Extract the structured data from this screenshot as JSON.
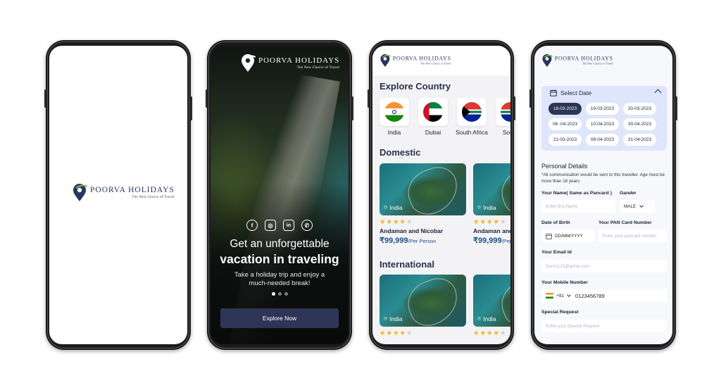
{
  "brand": {
    "name": "Poorva Holidays",
    "tagline": "The New Choice of Travel"
  },
  "splash": {},
  "onboarding": {
    "social_icons": [
      "facebook-icon",
      "instagram-icon",
      "linkedin-icon",
      "whatsapp-icon"
    ],
    "headline_1": "Get an unforgettable",
    "headline_2": "vacation in traveling",
    "subtext": "Take a holiday trip and enjoy a much-needed break!",
    "page_indicator": {
      "count": 3,
      "active": 1
    },
    "cta_label": "Explore Now"
  },
  "explore": {
    "section_country": "Explore Country",
    "countries": [
      {
        "label": "India"
      },
      {
        "label": "Dubai"
      },
      {
        "label": "South Africa"
      },
      {
        "label": "South"
      }
    ],
    "section_domestic": "Domestic",
    "domestic_cards": [
      {
        "location": "India",
        "rating": 4,
        "title": "Andaman and Nicobar",
        "price": "₹99,999",
        "per": "/Per Person"
      },
      {
        "location": "India",
        "rating": 4,
        "title": "Andaman and",
        "price": "₹99,999",
        "per": "/Per"
      }
    ],
    "section_international": "International",
    "international_cards": [
      {
        "location": "India",
        "rating": 4
      },
      {
        "location": "India",
        "rating": 4
      }
    ]
  },
  "booking": {
    "select_date": "Select Date",
    "dates": [
      "18-03-2023",
      "19-03-2023",
      "20-03-2023",
      "06 -04-2023",
      "10-04-2023",
      "30-04-2023",
      "21-03-2023",
      "08-04-2023",
      "31-04-2023"
    ],
    "selected_index": 0,
    "personal_details": "Personal Details",
    "note": "*All communication would be sent to this traveller. Age must be more than 18 years",
    "name_label": "Your Name( Same as Pancard )",
    "name_placeholder": "Enter first Name",
    "gender_label": "Gander",
    "gender_value": "MALE",
    "dob_label": "Date of Birth",
    "dob_placeholder": "DD/MM/YYYY",
    "pan_label": "Your PAN Card Number",
    "pan_placeholder": "Enter your pancard number",
    "email_label": "Your Email Id",
    "email_placeholder": "Demo123@gmail.com",
    "mobile_label": "Your Mobile Number",
    "country_code": "+91",
    "mobile_value": "0123456789",
    "request_label": "Special Request",
    "request_placeholder": "Enter your Special Request"
  },
  "colors": {
    "navy": "#2b3555",
    "accent_blue": "#1f4e8c",
    "star": "#f2b51b",
    "date_panel": "#dfe6fb"
  }
}
